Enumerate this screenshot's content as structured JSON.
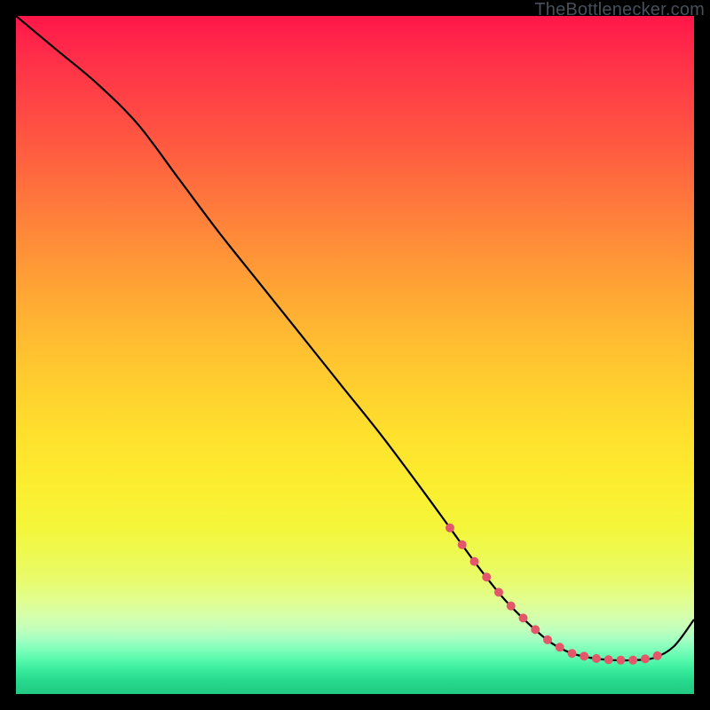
{
  "watermark": "TheBottlenecker.com",
  "chart_data": {
    "type": "line",
    "title": "",
    "xlabel": "",
    "ylabel": "",
    "xlim": [
      0,
      100
    ],
    "ylim": [
      0,
      100
    ],
    "x": [
      0,
      6,
      12,
      18,
      24,
      30,
      36,
      42,
      48,
      54,
      60,
      64,
      68,
      72,
      76,
      79,
      82,
      85,
      88,
      91,
      94,
      97,
      100
    ],
    "values": [
      100,
      95,
      90,
      84,
      76,
      68,
      60.5,
      53,
      45.5,
      38,
      30,
      24.5,
      19,
      14,
      10,
      7.5,
      6,
      5.3,
      5,
      5,
      5.3,
      7,
      11
    ],
    "dot_region": {
      "x_start": 64,
      "x_end": 95
    },
    "series_color": "#000000",
    "dot_color": "#e2586a",
    "gradient": "rainbow-vertical"
  }
}
